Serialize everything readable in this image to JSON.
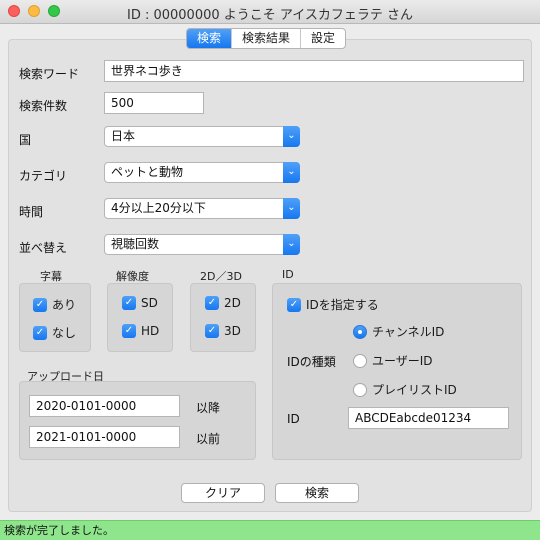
{
  "window": {
    "title": "ID : 00000000  ようこそ  アイスカフェラテ  さん"
  },
  "tabs": [
    {
      "label": "検索"
    },
    {
      "label": "検索結果"
    },
    {
      "label": "設定"
    }
  ],
  "form": {
    "keyword": {
      "label": "検索ワード",
      "value": "世界ネコ歩き"
    },
    "count": {
      "label": "検索件数",
      "value": "500"
    },
    "country": {
      "label": "国",
      "value": "日本"
    },
    "category": {
      "label": "カテゴリ",
      "value": "ペットと動物"
    },
    "duration": {
      "label": "時間",
      "value": "4分以上20分以下"
    },
    "sort": {
      "label": "並べ替え",
      "value": "視聴回数"
    }
  },
  "subtitles": {
    "title": "字幕",
    "options": [
      {
        "label": "あり",
        "checked": true
      },
      {
        "label": "なし",
        "checked": true
      }
    ]
  },
  "resolution": {
    "title": "解像度",
    "options": [
      {
        "label": "SD",
        "checked": true
      },
      {
        "label": "HD",
        "checked": true
      }
    ]
  },
  "dimension": {
    "title": "2D／3D",
    "options": [
      {
        "label": "2D",
        "checked": true
      },
      {
        "label": "3D",
        "checked": true
      }
    ]
  },
  "upload_date": {
    "title": "アップロード日",
    "from_value": "2020-0101-0000",
    "from_suffix": "以降",
    "to_value": "2021-0101-0000",
    "to_suffix": "以前"
  },
  "id_section": {
    "title": "ID",
    "specify": {
      "label": "IDを指定する",
      "checked": true
    },
    "type_label": "IDの種類",
    "types": [
      {
        "label": "チャンネルID",
        "selected": true
      },
      {
        "label": "ユーザーID",
        "selected": false
      },
      {
        "label": "プレイリストID",
        "selected": false
      }
    ],
    "id_label": "ID",
    "id_value": "ABCDEabcde01234"
  },
  "buttons": {
    "clear": "クリア",
    "search": "検索"
  },
  "status": {
    "message": "検索が完了しました。"
  },
  "colors": {
    "accent": "#1677f0",
    "status_bg": "#8ee58c"
  }
}
